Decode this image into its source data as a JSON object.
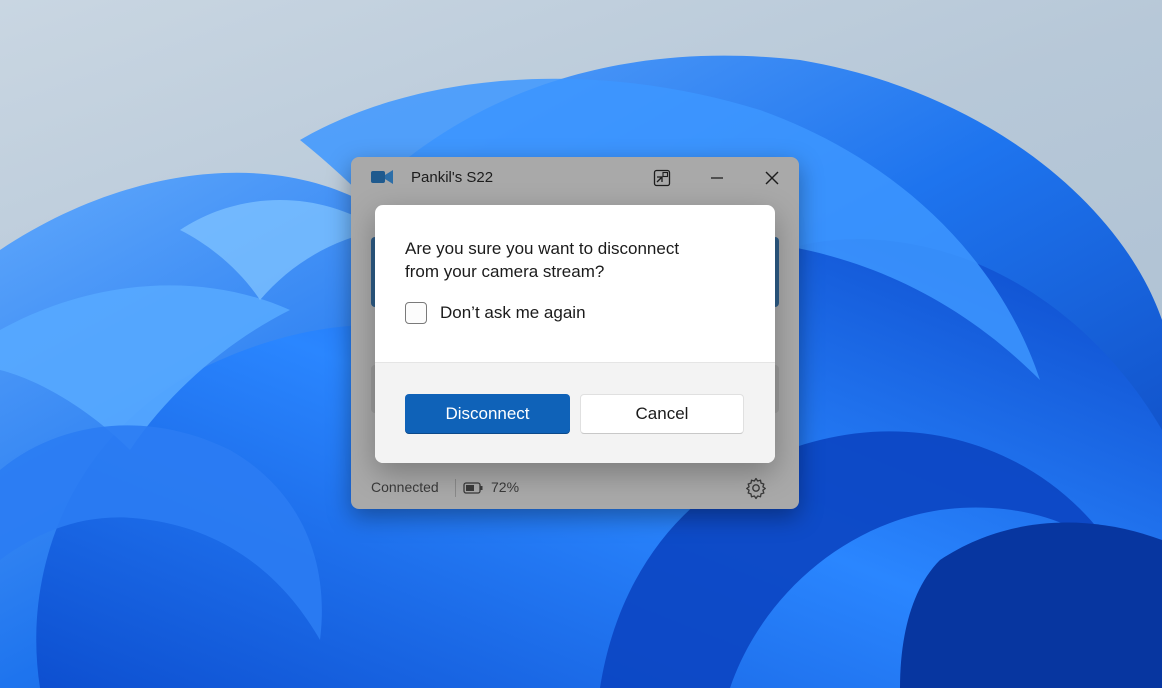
{
  "window": {
    "title": "Pankil's S22",
    "app_icon": "video-camera-icon",
    "title_buttons": [
      "picture-in-picture-icon",
      "minimize-icon",
      "close-icon"
    ]
  },
  "status": {
    "connection": "Connected",
    "battery": "72%",
    "battery_icon": "battery-icon",
    "settings_icon": "gear-icon"
  },
  "dialog": {
    "message_line1": "Are you sure you want to disconnect",
    "message_line2": "from your camera stream?",
    "checkbox_label": "Don’t ask me again",
    "checkbox_checked": false,
    "primary_button": "Disconnect",
    "secondary_button": "Cancel"
  },
  "colors": {
    "accent": "#0f62b8",
    "wallpaper_blue": "#1a6fe0"
  }
}
